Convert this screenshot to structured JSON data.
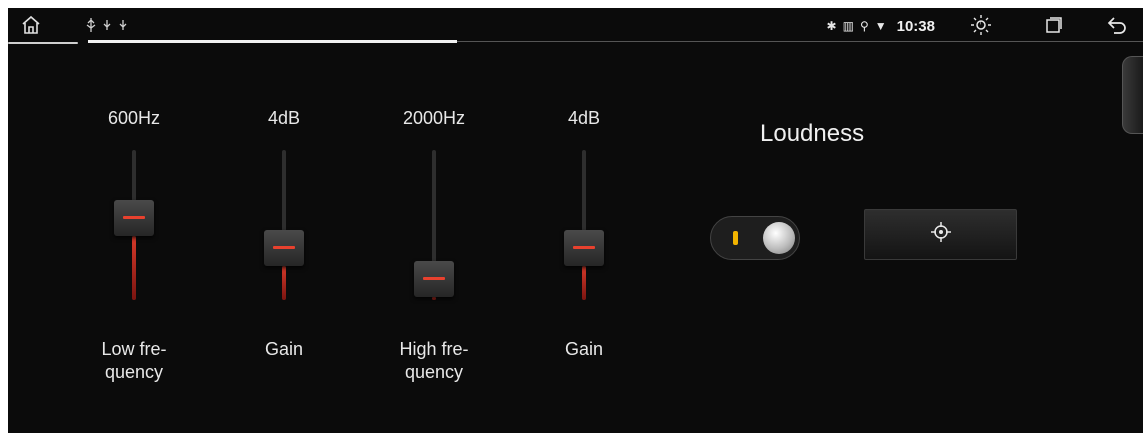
{
  "status_bar": {
    "icons": [
      "home-icon",
      "usb-icon",
      "usb-icon",
      "usb-icon",
      "bluetooth-icon",
      "signal-icon",
      "location-icon",
      "wifi-icon",
      "brightness-icon",
      "recent-apps-icon",
      "back-icon"
    ],
    "time": "10:38",
    "usb_glyphs": "⚲ ⚲ ⚲",
    "progress_fraction": 0.35
  },
  "equalizer": {
    "bands": [
      {
        "value": "600Hz",
        "label": "Low fre-\nquency",
        "level": 0.55
      },
      {
        "value": "4dB",
        "label": "Gain",
        "level": 0.35
      },
      {
        "value": "2000Hz",
        "label": "High fre-\nquency",
        "level": 0.1
      },
      {
        "value": "4dB",
        "label": "Gain",
        "level": 0.35
      }
    ]
  },
  "loudness": {
    "title": "Loudness",
    "toggle_on": true
  },
  "colors": {
    "accent_red": "#e8412e",
    "toggle_indicator": "#f2b400"
  }
}
